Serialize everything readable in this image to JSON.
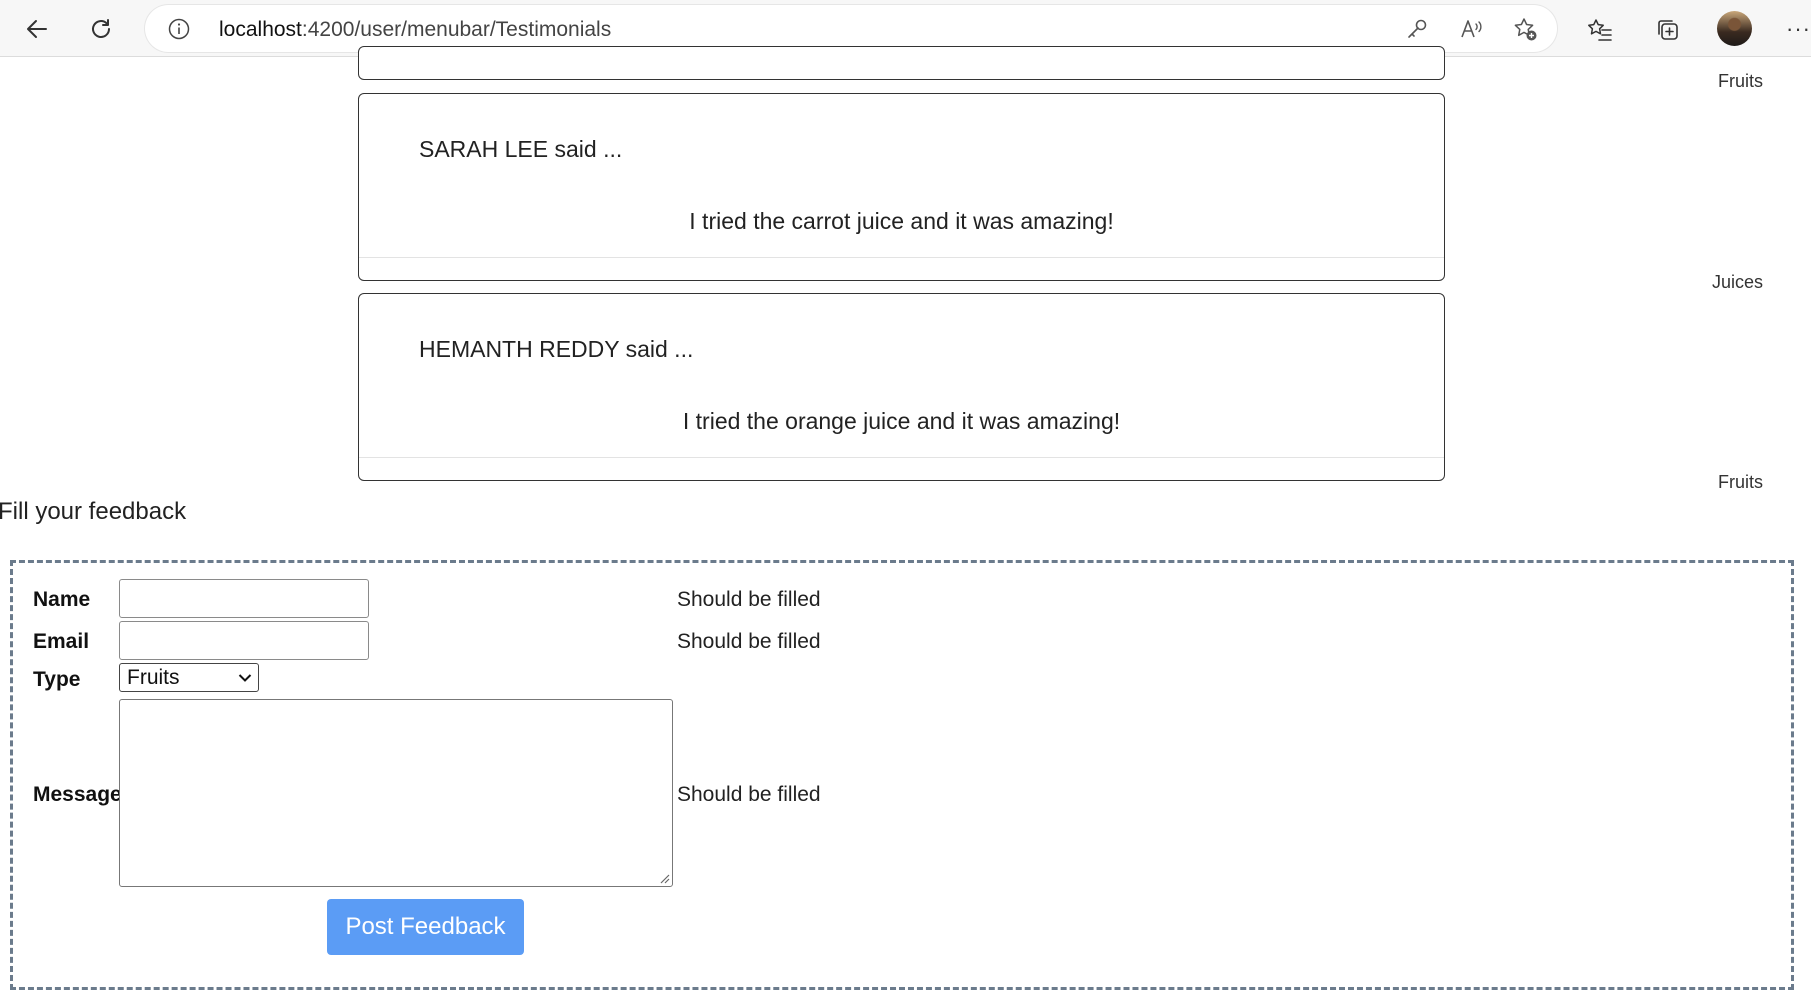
{
  "browser": {
    "url_host": "localhost",
    "url_path": ":4200/user/menubar/Testimonials"
  },
  "testimonials": {
    "prev_category": "Fruits",
    "items": [
      {
        "name_line": "SARAH LEE said ...",
        "message": "I tried the carrot juice and it was amazing!",
        "category": "Juices"
      },
      {
        "name_line": "HEMANTH REDDY said ...",
        "message": "I tried the orange juice and it was amazing!",
        "category": "Fruits"
      }
    ]
  },
  "feedback": {
    "title": "Fill your feedback",
    "name_label": "Name",
    "email_label": "Email",
    "type_label": "Type",
    "message_label": "Message",
    "name_value": "",
    "email_value": "",
    "type_selected": "Fruits",
    "name_error": "Should be filled",
    "email_error": "Should be filled",
    "message_error": "Should be filled",
    "submit_label": "Post Feedback"
  }
}
